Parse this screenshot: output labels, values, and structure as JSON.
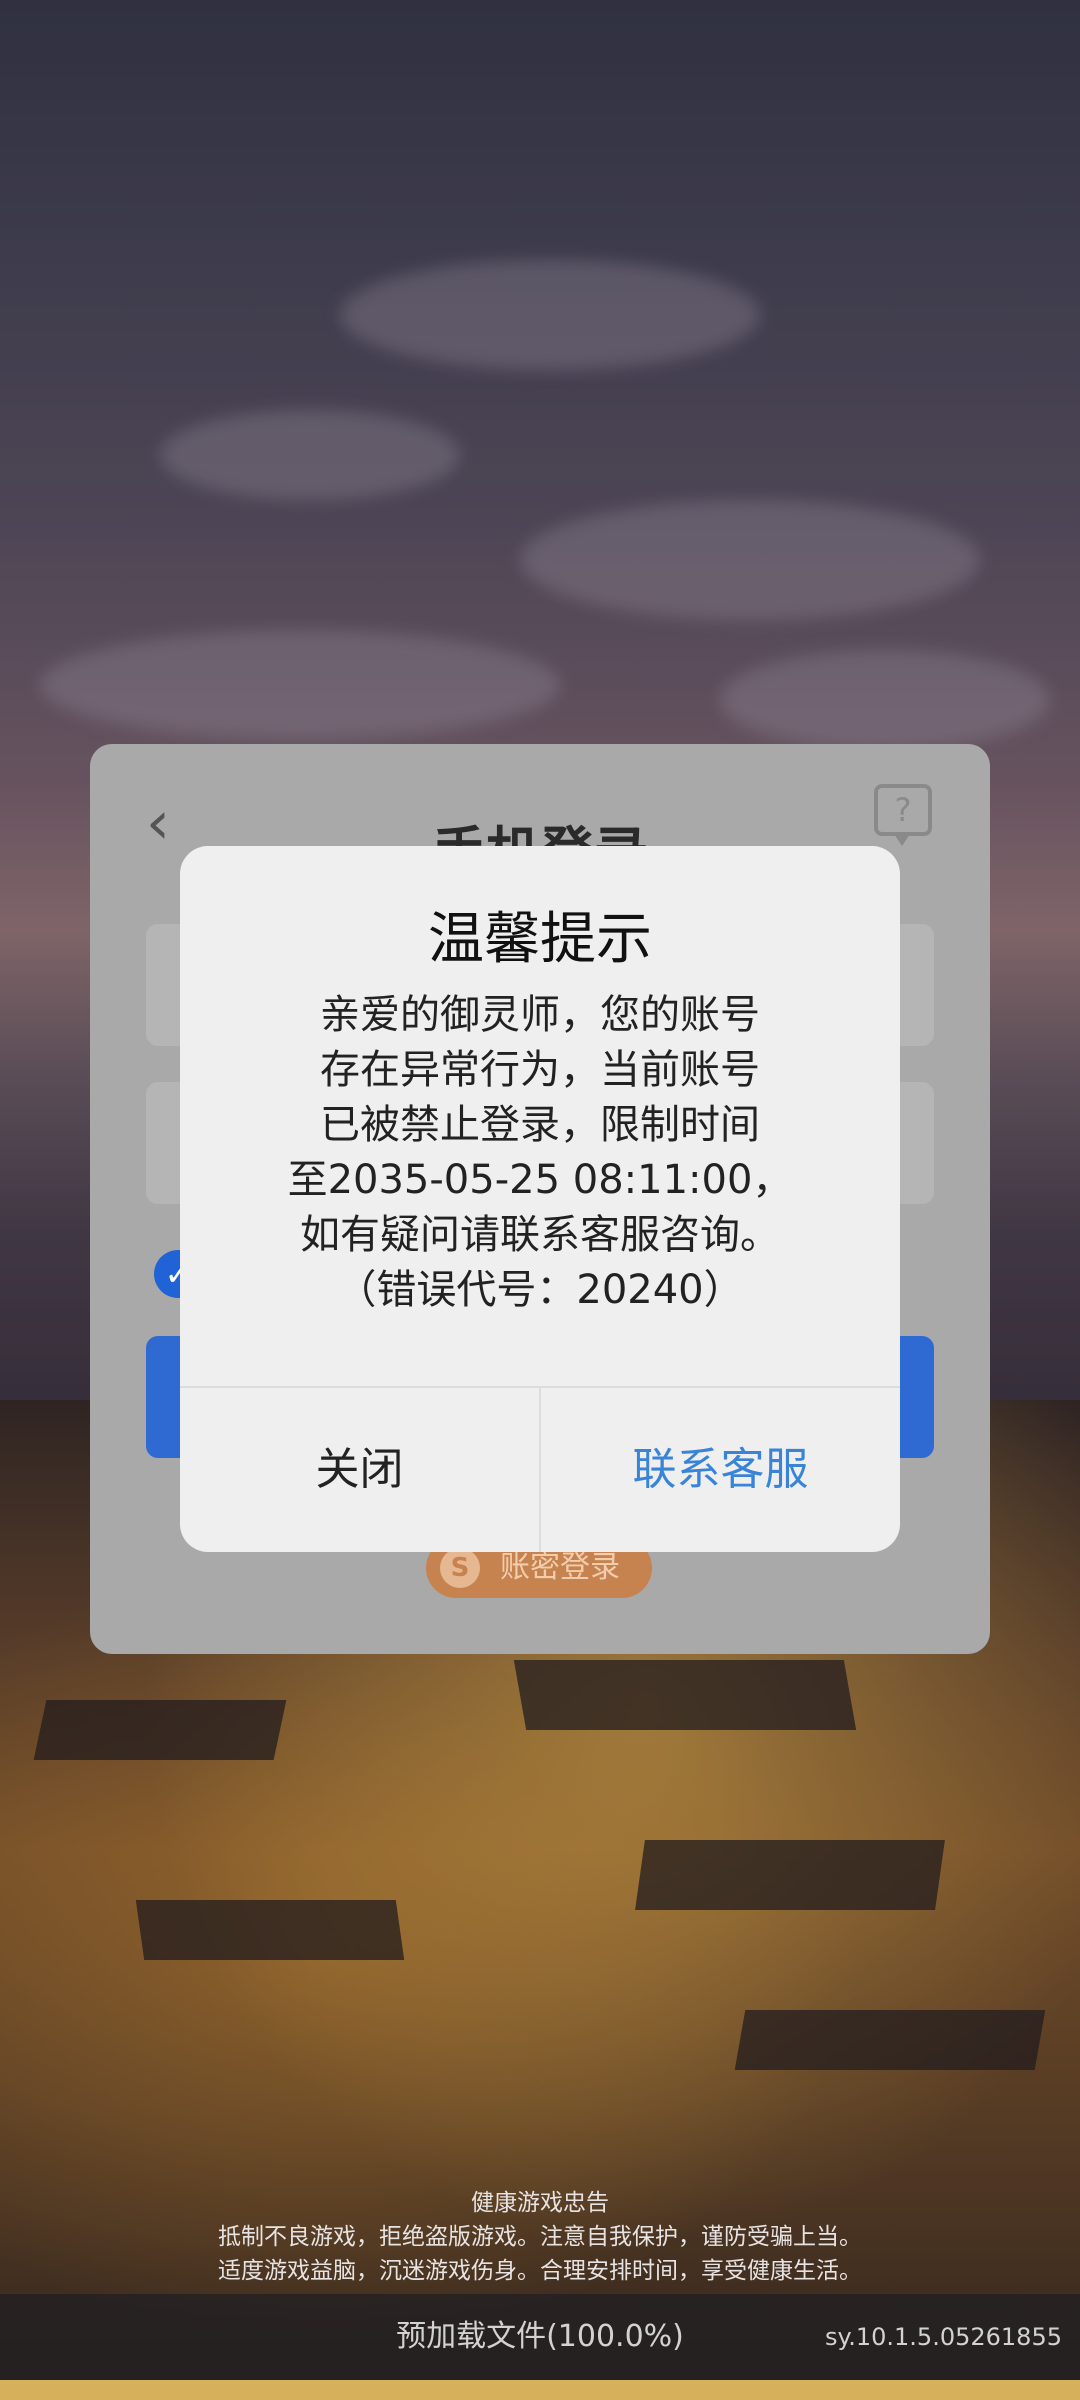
{
  "login_panel": {
    "title": "手机登录",
    "back_icon": "chevron-left-icon",
    "help_icon": "help-bubble-icon",
    "alt_login_label": "账密登录"
  },
  "dialog": {
    "title": "温馨提示",
    "message_lines": [
      "亲爱的御灵师，您的账号",
      "存在异常行为，当前账号",
      "已被禁止登录，限制时间",
      "至2035-05-25 08:11:00，",
      "如有疑问请联系客服咨询。",
      "（错误代号：20240）"
    ],
    "close_label": "关闭",
    "contact_label": "联系客服",
    "contact_color": "#3a84d8"
  },
  "health_notice": {
    "title": "健康游戏忠告",
    "line1": "抵制不良游戏，拒绝盗版游戏。注意自我保护，谨防受骗上当。",
    "line2": "适度游戏益脑，沉迷游戏伤身。合理安排时间，享受健康生活。"
  },
  "status": {
    "preload_text": "预加载文件(100.0%)",
    "version": "sy.10.1.5.05261855",
    "progress": 1.0,
    "progress_color": "#d7b05c"
  }
}
